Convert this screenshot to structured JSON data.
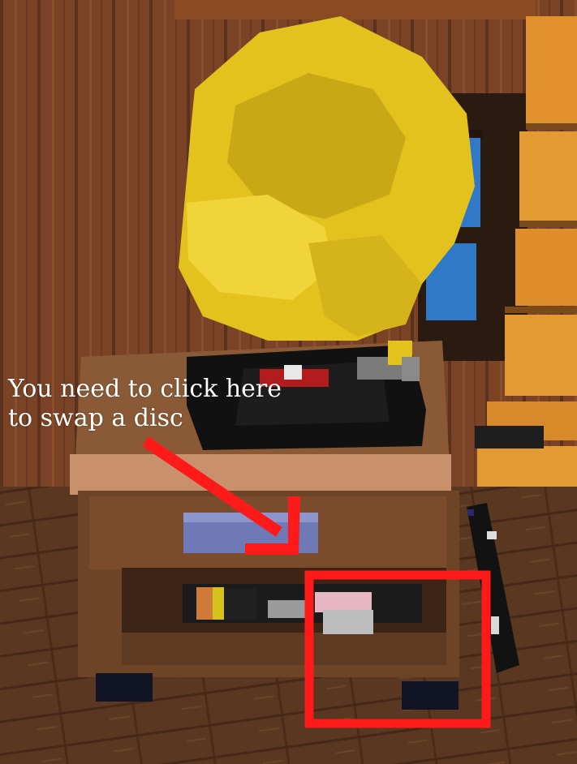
{
  "annotation": {
    "line1": "You need to click here",
    "line2": "to swap a disc",
    "arrow_color": "#ff1a1a",
    "box_color": "#ff1a1a",
    "text_color": "#ffffff"
  },
  "scene": {
    "horn_icon": "gramophone-horn-icon",
    "disc_icon": "music-disc-icon",
    "colors": {
      "wall_wood": "#7a4326",
      "floor_wood": "#5a3720",
      "horn_gold": "#e3c21e",
      "cabinet_top": "#c8916b",
      "cabinet_side": "#6e4427",
      "record_black": "#111111",
      "label_red": "#b21c1c",
      "handle_blue": "#6e79b5",
      "window_blue": "#2f79c6",
      "plank_orange": "#e0902c"
    }
  }
}
